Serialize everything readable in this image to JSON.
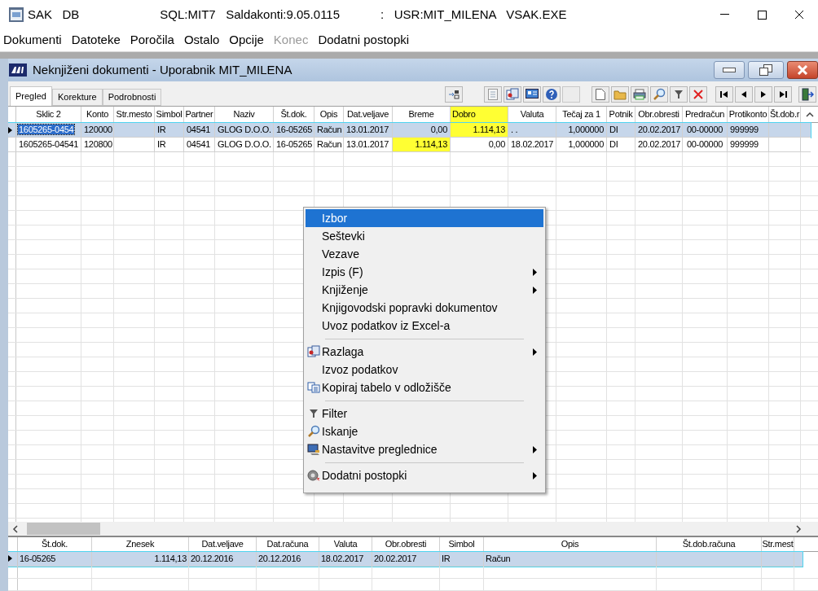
{
  "title_bar": {
    "app": "SAK   DB",
    "info": "SQL:MIT7   Saldakonti:9.05.0115",
    "user": ":   USR:MIT_MILENA   VSAK.EXE"
  },
  "menu_bar": [
    {
      "label": "Dokumenti",
      "disabled": false
    },
    {
      "label": "Datoteke",
      "disabled": false
    },
    {
      "label": "Poročila",
      "disabled": false
    },
    {
      "label": "Ostalo",
      "disabled": false
    },
    {
      "label": "Opcije",
      "disabled": false
    },
    {
      "label": "Konec",
      "disabled": true
    },
    {
      "label": "Dodatni postopki",
      "disabled": false
    }
  ],
  "child_window": {
    "title": "Neknjiženi dokumenti - Uporabnik MIT_MILENA"
  },
  "tabs": [
    {
      "label": "Pregled",
      "selected": true
    },
    {
      "label": "Korekture",
      "selected": false
    },
    {
      "label": "Podrobnosti",
      "selected": false
    }
  ],
  "table": {
    "columns": [
      {
        "label": "Sklic 2",
        "highlighted": false
      },
      {
        "label": "Konto",
        "highlighted": false
      },
      {
        "label": "Str.mesto",
        "highlighted": false
      },
      {
        "label": "Simbol",
        "highlighted": false
      },
      {
        "label": "Partner",
        "highlighted": false
      },
      {
        "label": "Naziv",
        "highlighted": false
      },
      {
        "label": "Št.dok.",
        "highlighted": false
      },
      {
        "label": "Opis",
        "highlighted": false
      },
      {
        "label": "Dat.veljave",
        "highlighted": false
      },
      {
        "label": "Breme",
        "highlighted": false
      },
      {
        "label": "Dobro",
        "highlighted": true
      },
      {
        "label": "Valuta",
        "highlighted": false
      },
      {
        "label": "Tečaj za 1",
        "highlighted": false
      },
      {
        "label": "Potnik",
        "highlighted": false
      },
      {
        "label": "Obr.obresti",
        "highlighted": false
      },
      {
        "label": "Predračun",
        "highlighted": false
      },
      {
        "label": "Protikonto",
        "highlighted": false
      },
      {
        "label": "Št.dob.r",
        "highlighted": false
      }
    ],
    "rows": [
      {
        "selected": true,
        "cells": [
          {
            "text": "1605265-0454",
            "highlighted": false,
            "focused": true
          },
          {
            "text": "120000",
            "highlighted": false,
            "focused": false
          },
          {
            "highlighted": false,
            "focused": false
          },
          {
            "text": "IR",
            "highlighted": false,
            "focused": false
          },
          {
            "text": "04541",
            "highlighted": false,
            "focused": false
          },
          {
            "text": "GLOG D.O.O.",
            "highlighted": false,
            "focused": false
          },
          {
            "text": "16-05265",
            "highlighted": false,
            "focused": false
          },
          {
            "text": "Račun",
            "highlighted": false,
            "focused": false
          },
          {
            "text": "13.01.2017",
            "highlighted": false,
            "focused": false
          },
          {
            "text": "0,00",
            "highlighted": false,
            "focused": false
          },
          {
            "text": "1.114,13",
            "highlighted": true,
            "focused": false
          },
          {
            "text": ". .",
            "highlighted": false,
            "focused": false
          },
          {
            "text": "1,000000",
            "highlighted": false,
            "focused": false
          },
          {
            "text": "DI",
            "highlighted": false,
            "focused": false
          },
          {
            "text": "20.02.2017",
            "highlighted": false,
            "focused": false
          },
          {
            "text": "00-00000",
            "highlighted": false,
            "focused": false
          },
          {
            "text": "999999",
            "highlighted": false,
            "focused": false
          },
          {
            "highlighted": false,
            "focused": false
          }
        ]
      },
      {
        "selected": false,
        "cells": [
          {
            "text": "1605265-04541",
            "highlighted": false,
            "focused": false
          },
          {
            "text": "120800",
            "highlighted": false,
            "focused": false
          },
          {
            "highlighted": false,
            "focused": false
          },
          {
            "text": "IR",
            "highlighted": false,
            "focused": false
          },
          {
            "text": "04541",
            "highlighted": false,
            "focused": false
          },
          {
            "text": "GLOG D.O.O.",
            "highlighted": false,
            "focused": false
          },
          {
            "text": "16-05265",
            "highlighted": false,
            "focused": false
          },
          {
            "text": "Račun",
            "highlighted": false,
            "focused": false
          },
          {
            "text": "13.01.2017",
            "highlighted": false,
            "focused": false
          },
          {
            "text": "1.114,13",
            "highlighted": true,
            "focused": false
          },
          {
            "text": "0,00",
            "highlighted": false,
            "focused": false
          },
          {
            "text": "18.02.2017",
            "highlighted": false,
            "focused": false
          },
          {
            "text": "1,000000",
            "highlighted": false,
            "focused": false
          },
          {
            "text": "DI",
            "highlighted": false,
            "focused": false
          },
          {
            "text": "20.02.2017",
            "highlighted": false,
            "focused": false
          },
          {
            "text": "00-00000",
            "highlighted": false,
            "focused": false
          },
          {
            "text": "999999",
            "highlighted": false,
            "focused": false
          },
          {
            "highlighted": false,
            "focused": false
          }
        ]
      }
    ]
  },
  "context_menu": [
    {
      "kind": "item",
      "label": "Izbor",
      "selected": true,
      "submenu": false
    },
    {
      "kind": "item",
      "label": "Seštevki",
      "selected": false,
      "submenu": false
    },
    {
      "kind": "item",
      "label": "Vezave",
      "selected": false,
      "submenu": false
    },
    {
      "kind": "item",
      "label": "Izpis (F)",
      "selected": false,
      "submenu": true
    },
    {
      "kind": "item",
      "label": "Knjiženje",
      "selected": false,
      "submenu": true
    },
    {
      "kind": "item",
      "label": "Knjigovodski popravki dokumentov",
      "selected": false,
      "submenu": false
    },
    {
      "kind": "item",
      "label": "Uvoz podatkov iz Excel-a",
      "selected": false,
      "submenu": false
    },
    {
      "kind": "separator"
    },
    {
      "kind": "item",
      "label": "Razlaga",
      "selected": false,
      "submenu": true
    },
    {
      "kind": "item",
      "label": "Izvoz podatkov",
      "selected": false,
      "submenu": false
    },
    {
      "kind": "item",
      "label": "Kopiraj tabelo v odložišče",
      "selected": false,
      "submenu": false
    },
    {
      "kind": "separator"
    },
    {
      "kind": "item",
      "label": "Filter",
      "selected": false,
      "submenu": false
    },
    {
      "kind": "item",
      "label": "Iskanje",
      "selected": false,
      "submenu": false
    },
    {
      "kind": "item",
      "label": "Nastavitve preglednice",
      "selected": false,
      "submenu": true
    },
    {
      "kind": "separator"
    },
    {
      "kind": "item",
      "label": "Dodatni postopki",
      "selected": false,
      "submenu": true
    }
  ],
  "detail_table": {
    "columns": [
      "Št.dok.",
      "Znesek",
      "Dat.veljave",
      "Dat.računa",
      "Valuta",
      "Obr.obresti",
      "Simbol",
      "Opis",
      "Št.dob.računa",
      "Str.mest"
    ],
    "rows": [
      {
        "selected": true,
        "cells": [
          "16-05265",
          "1.114,13",
          "20.12.2016",
          "20.12.2016",
          "18.02.2017",
          "20.02.2017",
          "IR",
          "Račun"
        ]
      }
    ]
  }
}
